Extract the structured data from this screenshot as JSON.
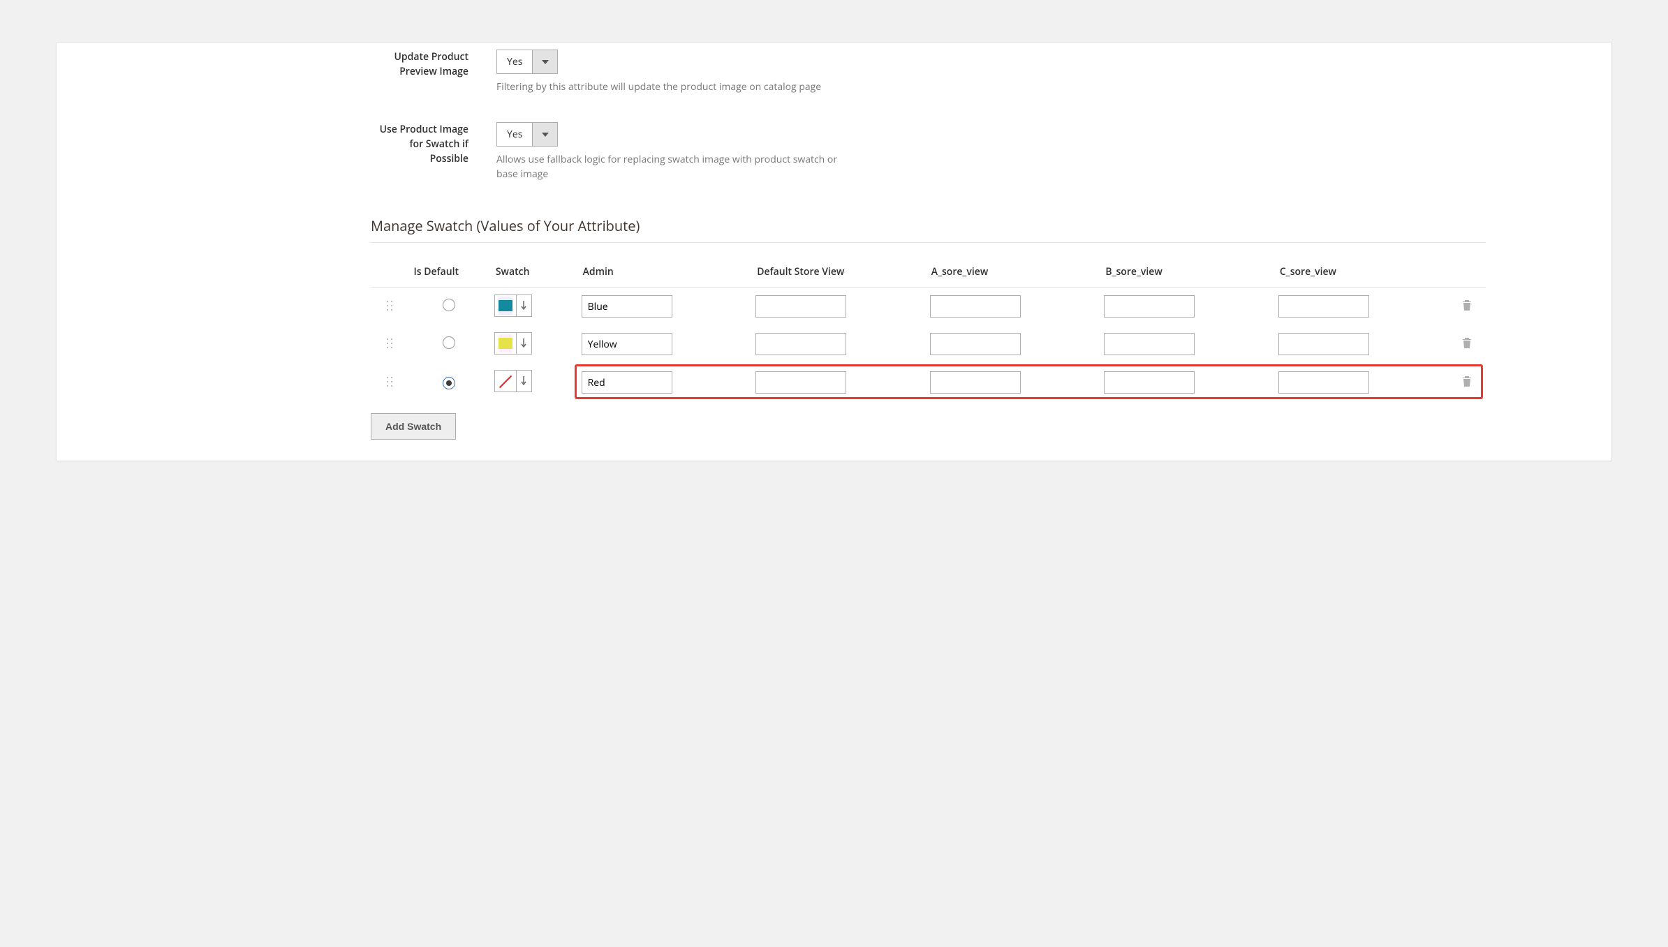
{
  "fields": {
    "update_preview": {
      "label": "Update Product Preview Image",
      "value": "Yes",
      "note": "Filtering by this attribute will update the product image on catalog page"
    },
    "use_product_image": {
      "label": "Use Product Image for Swatch if Possible",
      "value": "Yes",
      "note": "Allows use fallback logic for replacing swatch image with product swatch or base image"
    }
  },
  "section": {
    "title": "Manage Swatch (Values of Your Attribute)"
  },
  "table": {
    "headers": {
      "is_default": "Is Default",
      "swatch": "Swatch",
      "admin": "Admin",
      "default_store": "Default Store View",
      "a_view": "A_sore_view",
      "b_view": "B_sore_view",
      "c_view": "C_sore_view"
    },
    "rows": [
      {
        "is_default": false,
        "swatch_type": "blue",
        "admin": "Blue",
        "default_store": "",
        "a": "",
        "b": "",
        "c": "",
        "highlighted": false
      },
      {
        "is_default": false,
        "swatch_type": "yellow",
        "admin": "Yellow",
        "default_store": "",
        "a": "",
        "b": "",
        "c": "",
        "highlighted": false
      },
      {
        "is_default": true,
        "swatch_type": "empty",
        "admin": "Red",
        "default_store": "",
        "a": "",
        "b": "",
        "c": "",
        "highlighted": true
      }
    ]
  },
  "buttons": {
    "add_swatch": "Add Swatch"
  }
}
